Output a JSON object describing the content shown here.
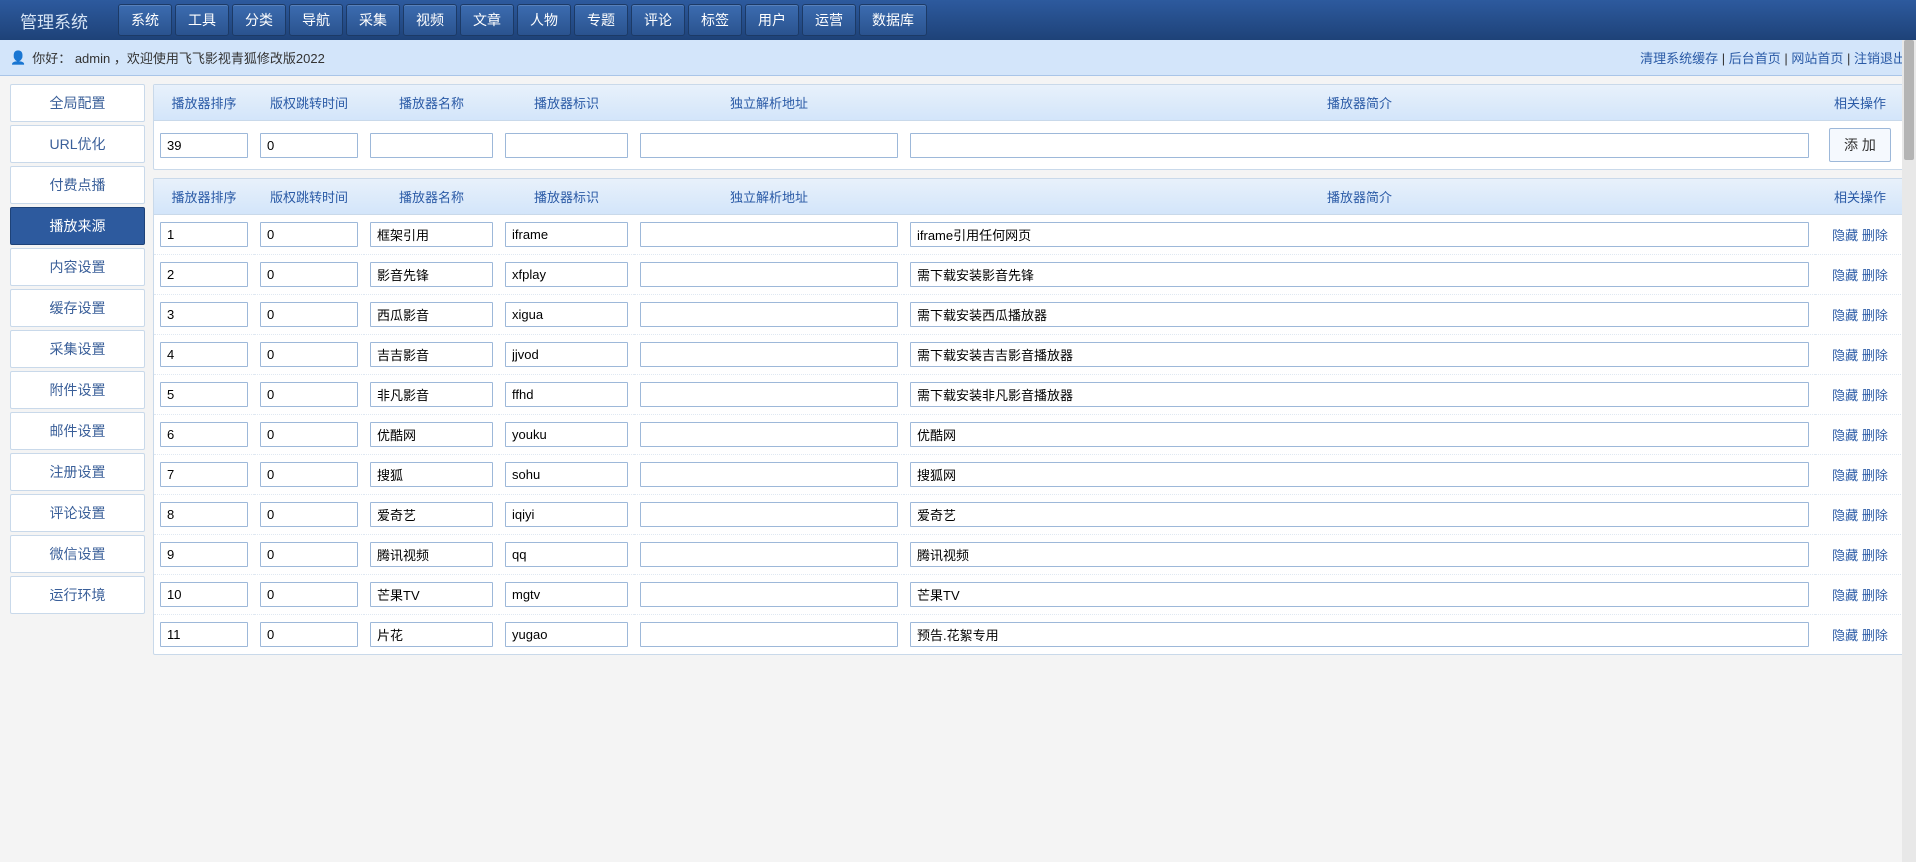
{
  "app_title": "管理系统",
  "top_nav": [
    "系统",
    "工具",
    "分类",
    "导航",
    "采集",
    "视频",
    "文章",
    "人物",
    "专题",
    "评论",
    "标签",
    "用户",
    "运营",
    "数据库"
  ],
  "welcome": {
    "hello_prefix": "你好：",
    "username": "admin",
    "suffix": "，欢迎使用飞飞影视青狐修改版2022"
  },
  "header_links": {
    "clear_cache": "清理系统缓存",
    "admin_home": "后台首页",
    "site_home": "网站首页",
    "logout": "注销退出",
    "sep": " | "
  },
  "sidebar": {
    "items": [
      {
        "label": "全局配置",
        "active": false
      },
      {
        "label": "URL优化",
        "active": false
      },
      {
        "label": "付费点播",
        "active": false
      },
      {
        "label": "播放来源",
        "active": true
      },
      {
        "label": "内容设置",
        "active": false
      },
      {
        "label": "缓存设置",
        "active": false
      },
      {
        "label": "采集设置",
        "active": false
      },
      {
        "label": "附件设置",
        "active": false
      },
      {
        "label": "邮件设置",
        "active": false
      },
      {
        "label": "注册设置",
        "active": false
      },
      {
        "label": "评论设置",
        "active": false
      },
      {
        "label": "微信设置",
        "active": false
      },
      {
        "label": "运行环境",
        "active": false
      }
    ]
  },
  "columns": {
    "sort": "播放器排序",
    "jump": "版权跳转时间",
    "name": "播放器名称",
    "ident": "播放器标识",
    "url": "独立解析地址",
    "desc": "播放器简介",
    "ops": "相关操作"
  },
  "add_row": {
    "sort": "39",
    "jump": "0",
    "name": "",
    "ident": "",
    "url": "",
    "desc": "",
    "btn": "添 加"
  },
  "ops": {
    "hide": "隐藏",
    "delete": "删除"
  },
  "rows": [
    {
      "sort": "1",
      "jump": "0",
      "name": "框架引用",
      "ident": "iframe",
      "url": "",
      "desc": "iframe引用任何网页"
    },
    {
      "sort": "2",
      "jump": "0",
      "name": "影音先锋",
      "ident": "xfplay",
      "url": "",
      "desc": "需下载安装影音先锋"
    },
    {
      "sort": "3",
      "jump": "0",
      "name": "西瓜影音",
      "ident": "xigua",
      "url": "",
      "desc": "需下载安装西瓜播放器"
    },
    {
      "sort": "4",
      "jump": "0",
      "name": "吉吉影音",
      "ident": "jjvod",
      "url": "",
      "desc": "需下载安装吉吉影音播放器"
    },
    {
      "sort": "5",
      "jump": "0",
      "name": "非凡影音",
      "ident": "ffhd",
      "url": "",
      "desc": "需下载安装非凡影音播放器"
    },
    {
      "sort": "6",
      "jump": "0",
      "name": "优酷网",
      "ident": "youku",
      "url": "",
      "desc": "优酷网"
    },
    {
      "sort": "7",
      "jump": "0",
      "name": "搜狐",
      "ident": "sohu",
      "url": "",
      "desc": "搜狐网"
    },
    {
      "sort": "8",
      "jump": "0",
      "name": "爱奇艺",
      "ident": "iqiyi",
      "url": "",
      "desc": "爱奇艺"
    },
    {
      "sort": "9",
      "jump": "0",
      "name": "腾讯视频",
      "ident": "qq",
      "url": "",
      "desc": "腾讯视频"
    },
    {
      "sort": "10",
      "jump": "0",
      "name": "芒果TV",
      "ident": "mgtv",
      "url": "",
      "desc": "芒果TV"
    },
    {
      "sort": "11",
      "jump": "0",
      "name": "片花",
      "ident": "yugao",
      "url": "",
      "desc": "预告.花絮专用"
    }
  ]
}
